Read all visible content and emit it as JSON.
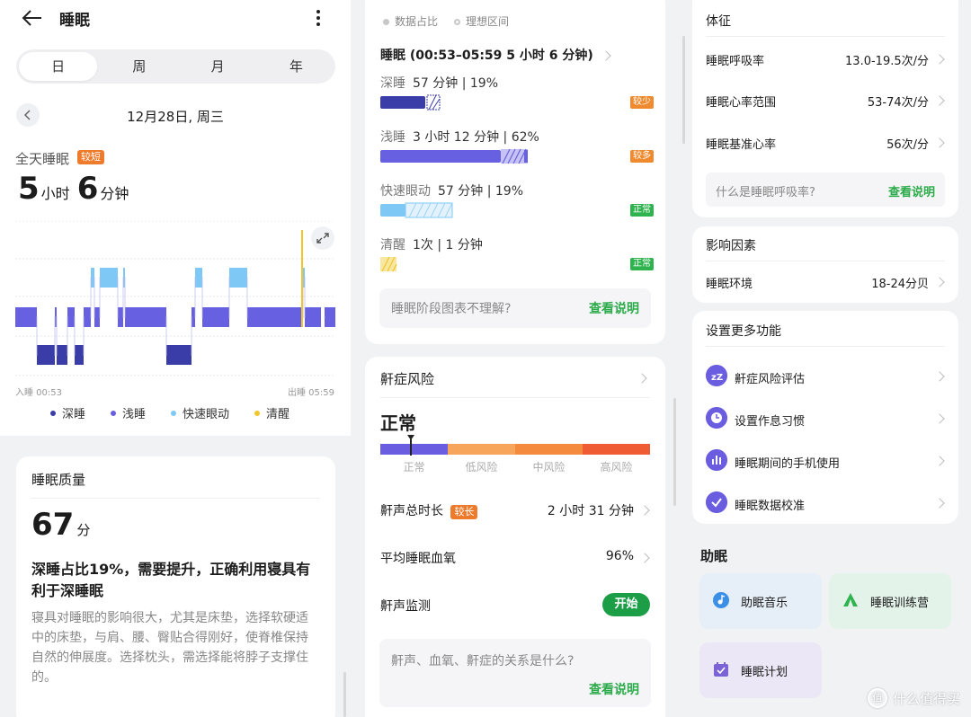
{
  "header": {
    "title": "睡眠"
  },
  "tabs": [
    "日",
    "周",
    "月",
    "年"
  ],
  "date": "12月28日, 周三",
  "summary": {
    "label": "全天睡眠",
    "badge": "较短",
    "hours": "5",
    "hours_unit": "小时",
    "minutes": "6",
    "minutes_unit": "分钟"
  },
  "hypnogram": {
    "start": "入睡 00:53",
    "end": "出睡 05:59"
  },
  "legend": [
    {
      "label": "深睡",
      "color": "#3a3da8"
    },
    {
      "label": "浅睡",
      "color": "#6760e0"
    },
    {
      "label": "快速眼动",
      "color": "#7ec8f5"
    },
    {
      "label": "清醒",
      "color": "#f1c62a"
    }
  ],
  "quality": {
    "title": "睡眠质量",
    "score": "67",
    "score_unit": "分",
    "headline": "深睡占比19%，需要提升，正确利用寝具有利于深睡眠",
    "body": "寝具对睡眠的影响很大，尤其是床垫，选择软硬适中的床垫，与肩、腰、臀贴合得刚好，使脊椎保持自然的伸展度。选择枕头，需选择能将脖子支撑住的。"
  },
  "stages": {
    "legend": [
      "数据占比",
      "理想区间"
    ],
    "range": "睡眠 (00:53–05:59  5 小时 6 分钟)",
    "items": [
      {
        "name": "深睡",
        "value": "57 分钟 | 19%",
        "badge": "较少",
        "badge_color": "#ef8a2f",
        "fill": 0.19,
        "color": "#3a3da8"
      },
      {
        "name": "浅睡",
        "value": "3 小时 12 分钟 | 62%",
        "badge": "较多",
        "badge_color": "#ef8a2f",
        "fill": 0.62,
        "color": "#6760e0"
      },
      {
        "name": "快速眼动",
        "value": "57 分钟 | 19%",
        "badge": "正常",
        "badge_color": "#2fb34e",
        "fill": 0.19,
        "color": "#7ec8f5"
      },
      {
        "name": "清醒",
        "value": "1次 |  1 分钟",
        "badge": "正常",
        "badge_color": "#2fb34e",
        "fill": 0.0,
        "color": "#f1c62a"
      }
    ],
    "help_q": "睡眠阶段图表不理解?",
    "help_a": "查看说明"
  },
  "snore": {
    "title": "鼾症风险",
    "status": "正常",
    "levels": [
      "正常",
      "低风险",
      "中风险",
      "高风险"
    ],
    "level_colors": [
      "#6a5de0",
      "#f6a55a",
      "#f38a3e",
      "#ef5b32"
    ],
    "rows": [
      {
        "k": "鼾声总时长",
        "badge": "较长",
        "v": "2 小时 31 分钟"
      },
      {
        "k": "平均睡眠血氧",
        "v": "96%"
      }
    ],
    "monitor": "鼾声监测",
    "start": "开始",
    "help_q": "鼾声、血氧、鼾症的关系是什么?",
    "help_a": "查看说明"
  },
  "vitals": {
    "title": "体征",
    "rows": [
      {
        "k": "睡眠呼吸率",
        "v": "13.0-19.5次/分"
      },
      {
        "k": "睡眠心率范围",
        "v": "53-74次/分"
      },
      {
        "k": "睡眠基准心率",
        "v": "56次/分"
      }
    ],
    "help_q": "什么是睡眠呼吸率?",
    "help_a": "查看说明"
  },
  "factors": {
    "title": "影响因素",
    "rows": [
      {
        "k": "睡眠环境",
        "v": "18-24分贝"
      }
    ]
  },
  "more": {
    "title": "设置更多功能",
    "items": [
      "鼾症风险评估",
      "设置作息习惯",
      "睡眠期间的手机使用",
      "睡眠数据校准"
    ],
    "icons": [
      "zzz-icon",
      "clock-icon",
      "bar-chart-icon",
      "check-icon"
    ]
  },
  "helper": {
    "title": "助眠",
    "tiles": [
      {
        "label": "助眠音乐",
        "bg": "#e6eef8",
        "icon": "music-icon"
      },
      {
        "label": "睡眠训练营",
        "bg": "#e4f3ea",
        "icon": "tent-icon"
      },
      {
        "label": "睡眠计划",
        "bg": "#ebe7f6",
        "icon": "calendar-icon"
      }
    ]
  },
  "watermark": {
    "logo": "值",
    "text": "什么值得买"
  }
}
